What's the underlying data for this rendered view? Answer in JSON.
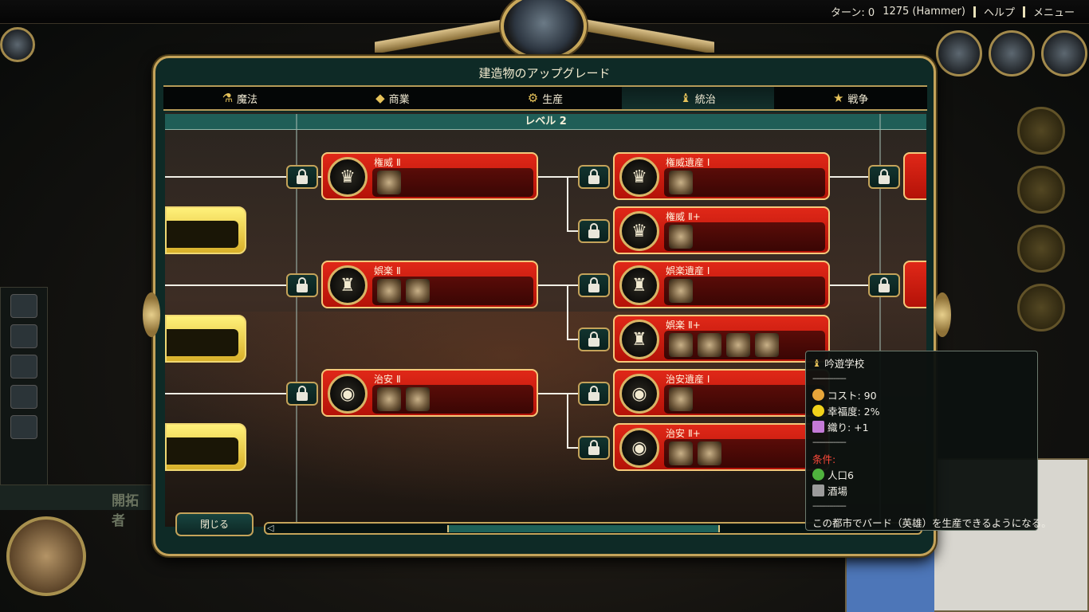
{
  "topbar": {
    "turn": "ターン: 0",
    "year": "1275 (Hammer)",
    "help": "ヘルプ",
    "menu": "メニュー"
  },
  "left_panel": {
    "settler_label": "開拓者"
  },
  "dialog": {
    "title": "建造物のアップグレード",
    "tabs": [
      {
        "label": "魔法",
        "icon": "flask-icon"
      },
      {
        "label": "商業",
        "icon": "gem-icon"
      },
      {
        "label": "生産",
        "icon": "gear-icon"
      },
      {
        "label": "統治",
        "icon": "scepter-icon"
      },
      {
        "label": "戦争",
        "icon": "star-icon"
      }
    ],
    "active_tab": "統治",
    "level_label": "レベル 2",
    "nodes": [
      {
        "name": "権威 Ⅱ",
        "buildings": 1
      },
      {
        "name": "権威遺産 Ⅰ",
        "buildings": 1
      },
      {
        "name": "権威 Ⅱ+",
        "buildings": 1
      },
      {
        "name": "娯楽 Ⅱ",
        "buildings": 2
      },
      {
        "name": "娯楽遺産 Ⅰ",
        "buildings": 1
      },
      {
        "name": "娯楽 Ⅱ+",
        "buildings": 4
      },
      {
        "name": "治安 Ⅱ",
        "buildings": 2
      },
      {
        "name": "治安遺産 Ⅰ",
        "buildings": 1
      },
      {
        "name": "治安 Ⅱ+",
        "buildings": 2
      }
    ],
    "close_label": "閉じる"
  },
  "tooltip": {
    "title": "吟遊学校",
    "divider": "----------------",
    "cost": "コスト: 90",
    "happiness": "幸福度: 2%",
    "weave": "織り: +1",
    "requirements_label": "条件:",
    "req_population": "人口6",
    "req_building": "酒場",
    "description": "この都市でバード（英雄）を生産できるようになる。"
  },
  "colors": {
    "node_red": "#d0200f",
    "gold": "#c4a35a",
    "teal": "#0e2a26",
    "req_red": "#ff4a3a"
  }
}
